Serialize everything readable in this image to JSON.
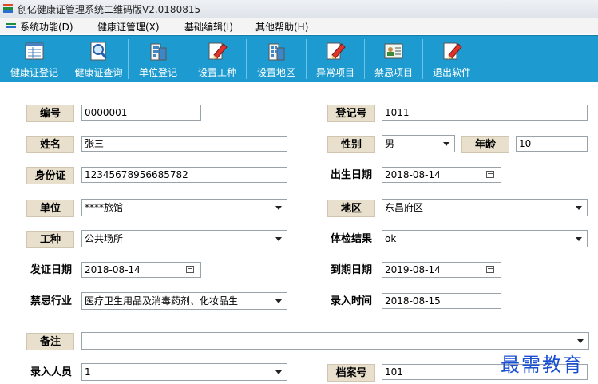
{
  "window": {
    "title": "创亿健康证管理系统二维码版V2.0180815",
    "icon": "app-logo-icon"
  },
  "menu": [
    "系统功能(D)",
    "健康证管理(X)",
    "基础编辑(I)",
    "其他帮助(H)"
  ],
  "toolbar": [
    {
      "label": "健康证登记",
      "icon": "form-register-icon"
    },
    {
      "label": "健康证查询",
      "icon": "magnifier-search-icon"
    },
    {
      "label": "单位登记",
      "icon": "building-icon"
    },
    {
      "label": "设置工种",
      "icon": "pencil-edit-icon"
    },
    {
      "label": "设置地区",
      "icon": "building-icon"
    },
    {
      "label": "异常项目",
      "icon": "pencil-edit-icon"
    },
    {
      "label": "禁忌项目",
      "icon": "id-card-icon"
    },
    {
      "label": "退出软件",
      "icon": "pencil-edit-icon"
    }
  ],
  "form": {
    "number": {
      "label": "编号",
      "value": "0000001"
    },
    "reg_no": {
      "label": "登记号",
      "value": "1011"
    },
    "name": {
      "label": "姓名",
      "value": "张三"
    },
    "gender": {
      "label": "性别",
      "value": "男"
    },
    "age": {
      "label": "年龄",
      "value": "10"
    },
    "id_card": {
      "label": "身份证",
      "value": "12345678956685782"
    },
    "birth_date": {
      "label": "出生日期",
      "value": "2018-08-14"
    },
    "unit": {
      "label": "单位",
      "value": "****旅馆"
    },
    "region": {
      "label": "地区",
      "value": "东昌府区"
    },
    "job_type": {
      "label": "工种",
      "value": "公共场所"
    },
    "exam_result": {
      "label": "体检结果",
      "value": "ok"
    },
    "issue_date": {
      "label": "发证日期",
      "value": "2018-08-14"
    },
    "expire_date": {
      "label": "到期日期",
      "value": "2019-08-14"
    },
    "forbidden_industry": {
      "label": "禁忌行业",
      "value": "医疗卫生用品及消毒药剂、化妆品生"
    },
    "entry_time": {
      "label": "录入时间",
      "value": "2018-08-15"
    },
    "remark": {
      "label": "备注",
      "value": ""
    },
    "entry_person": {
      "label": "录入人员",
      "value": "1"
    },
    "archive_no": {
      "label": "档案号",
      "value": "101"
    }
  },
  "watermark": "最需教育",
  "colors": {
    "toolbar_bg": "#1d9bd0",
    "label_bg": "#e8e0cc",
    "watermark": "#1a4fd1"
  }
}
